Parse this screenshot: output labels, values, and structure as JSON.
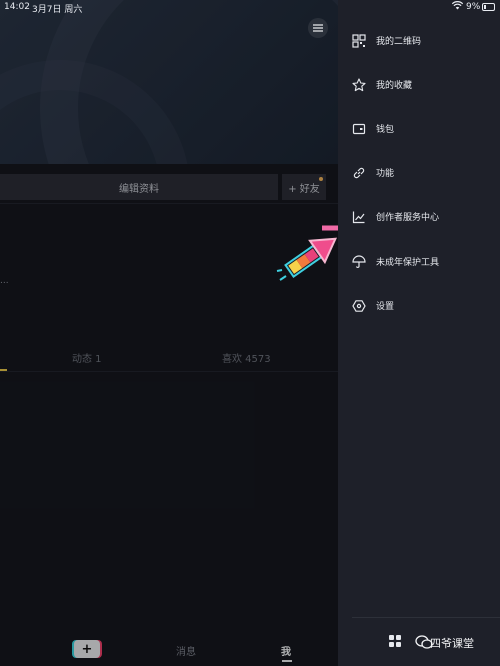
{
  "status_bar": {
    "time": "14:02",
    "date": "3月7日 周六",
    "wifi_icon": "wifi-icon",
    "battery_percent": "9%"
  },
  "profile": {
    "edit_profile_label": "编辑资料",
    "add_friend_label": "+ 好友",
    "ellipsis": "...",
    "tabs": {
      "dynamic": "动态 1",
      "likes": "喜欢 4573"
    }
  },
  "bottom_nav": {
    "plus_label": "+",
    "messages": "消息",
    "me": "我"
  },
  "drawer": {
    "items": [
      {
        "label": "我的二维码",
        "icon": "qr-code-icon"
      },
      {
        "label": "我的收藏",
        "icon": "star-icon"
      },
      {
        "label": "钱包",
        "icon": "wallet-icon"
      },
      {
        "label": "功能",
        "icon": "link-icon"
      },
      {
        "label": "创作者服务中心",
        "icon": "chart-icon"
      },
      {
        "label": "未成年保护工具",
        "icon": "umbrella-icon"
      },
      {
        "label": "设置",
        "icon": "settings-icon"
      }
    ],
    "watermark": "四爷课堂"
  },
  "colors": {
    "accent_yellow": "#e8c84a",
    "drawer_bg": "#1e2029",
    "page_bg": "#15171e"
  }
}
